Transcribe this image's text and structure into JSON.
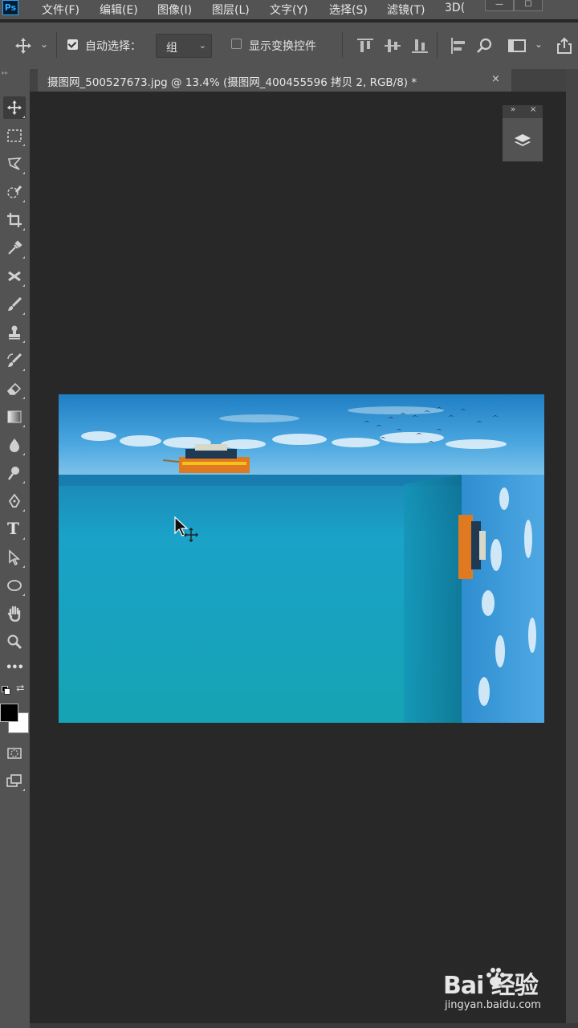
{
  "app": {
    "logo": "Ps"
  },
  "menu": [
    "文件(F)",
    "编辑(E)",
    "图像(I)",
    "图层(L)",
    "文字(Y)",
    "选择(S)",
    "滤镜(T)",
    "3D("
  ],
  "window_controls": [
    "—",
    "☐"
  ],
  "options": {
    "auto_select_label": "自动选择：",
    "auto_select_checked": true,
    "auto_select_value": "组",
    "show_transform_label": "显示变换控件",
    "show_transform_checked": false
  },
  "document_tab": {
    "title": "摄图网_500527673.jpg @ 13.4% (摄图网_400455596 拷贝 2, RGB/8) *",
    "close": "×"
  },
  "float_panel": {
    "collapse": "»",
    "close": "×",
    "icon": "layers-icon"
  },
  "tools": [
    "move-tool-icon",
    "marquee-tool-icon",
    "lasso-tool-icon",
    "quick-selection-tool-icon",
    "crop-tool-icon",
    "eyedropper-tool-icon",
    "healing-tool-icon",
    "brush-tool-icon",
    "clone-stamp-tool-icon",
    "history-brush-tool-icon",
    "eraser-tool-icon",
    "gradient-tool-icon",
    "blur-tool-icon",
    "dodge-tool-icon",
    "pen-tool-icon",
    "type-tool-icon",
    "path-selection-tool-icon",
    "ellipse-tool-icon",
    "hand-tool-icon",
    "zoom-tool-icon",
    "more-tools-icon"
  ],
  "tool_labels": {
    "type": "T",
    "more": "•••"
  },
  "colors": {
    "foreground": "#000000",
    "background": "#ffffff",
    "ui_panel": "#535353",
    "canvas_bg": "#282828"
  },
  "watermark": {
    "brand": "Bai  经验",
    "url": "jingyan.baidu.com"
  }
}
